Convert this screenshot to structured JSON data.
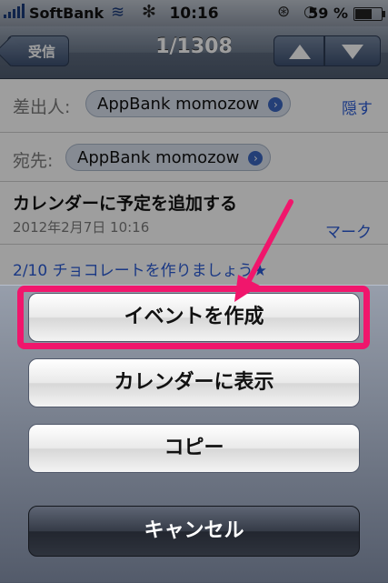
{
  "status": {
    "carrier": "SoftBank",
    "time": "10:16",
    "battery": "59 %"
  },
  "nav": {
    "back_label": "受信",
    "title": "1/1308"
  },
  "mail": {
    "from_label": "差出人:",
    "from_value": "AppBank momozow",
    "hide_link": "隠す",
    "to_label": "宛先:",
    "to_value": "AppBank momozow",
    "subject": "カレンダーに予定を追加する",
    "date": "2012年2月7日 10:16",
    "mark_link": "マーク",
    "body_preview": "2/10 チョコレートを作りましょう★"
  },
  "sheet": {
    "create_event": "イベントを作成",
    "show_calendar": "カレンダーに表示",
    "copy": "コピー",
    "cancel": "キャンセル"
  },
  "colors": {
    "highlight": "#f0166c",
    "link": "#2a5bd6"
  }
}
